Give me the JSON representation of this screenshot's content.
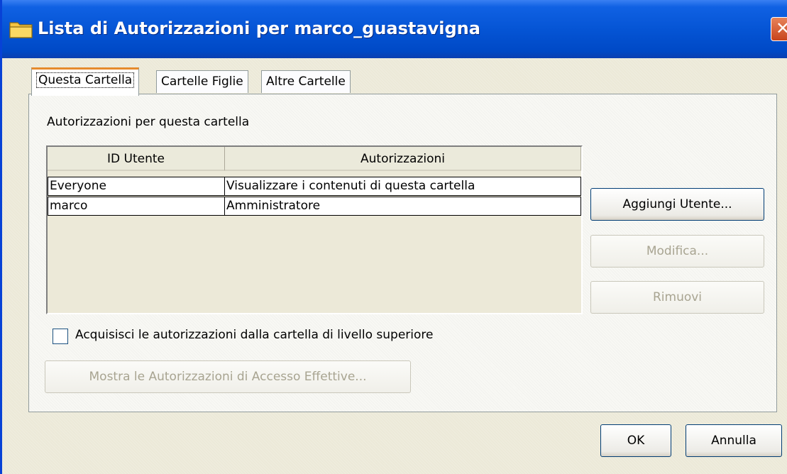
{
  "window": {
    "title": "Lista di Autorizzazioni per marco_guastavigna",
    "close_glyph": "✕",
    "icon": "folder-icon"
  },
  "tabs": [
    {
      "label": "Questa Cartella",
      "active": true
    },
    {
      "label": "Cartelle Figlie",
      "active": false
    },
    {
      "label": "Altre Cartelle",
      "active": false
    }
  ],
  "panel": {
    "group_label": "Autorizzazioni per questa cartella",
    "table": {
      "columns": [
        "ID Utente",
        "Autorizzazioni"
      ],
      "rows": [
        {
          "user": "Everyone",
          "permission": "Visualizzare i contenuti di questa cartella"
        },
        {
          "user": "marco",
          "permission": "Amministratore"
        }
      ]
    },
    "buttons": {
      "add_user": "Aggiungi Utente...",
      "modify": "Modifica...",
      "remove": "Rimuovi"
    },
    "inherit_checkbox": {
      "label": "Acquisisci le autorizzazioni dalla cartella di livello superiore",
      "checked": false
    },
    "effective_button": "Mostra le Autorizzazioni di Accesso Effettive..."
  },
  "footer": {
    "ok": "OK",
    "cancel": "Annulla"
  },
  "colors": {
    "titlebar": "#0453d3",
    "active_tab_accent": "#e68b2c",
    "dialog_bg": "#ece9d8"
  }
}
